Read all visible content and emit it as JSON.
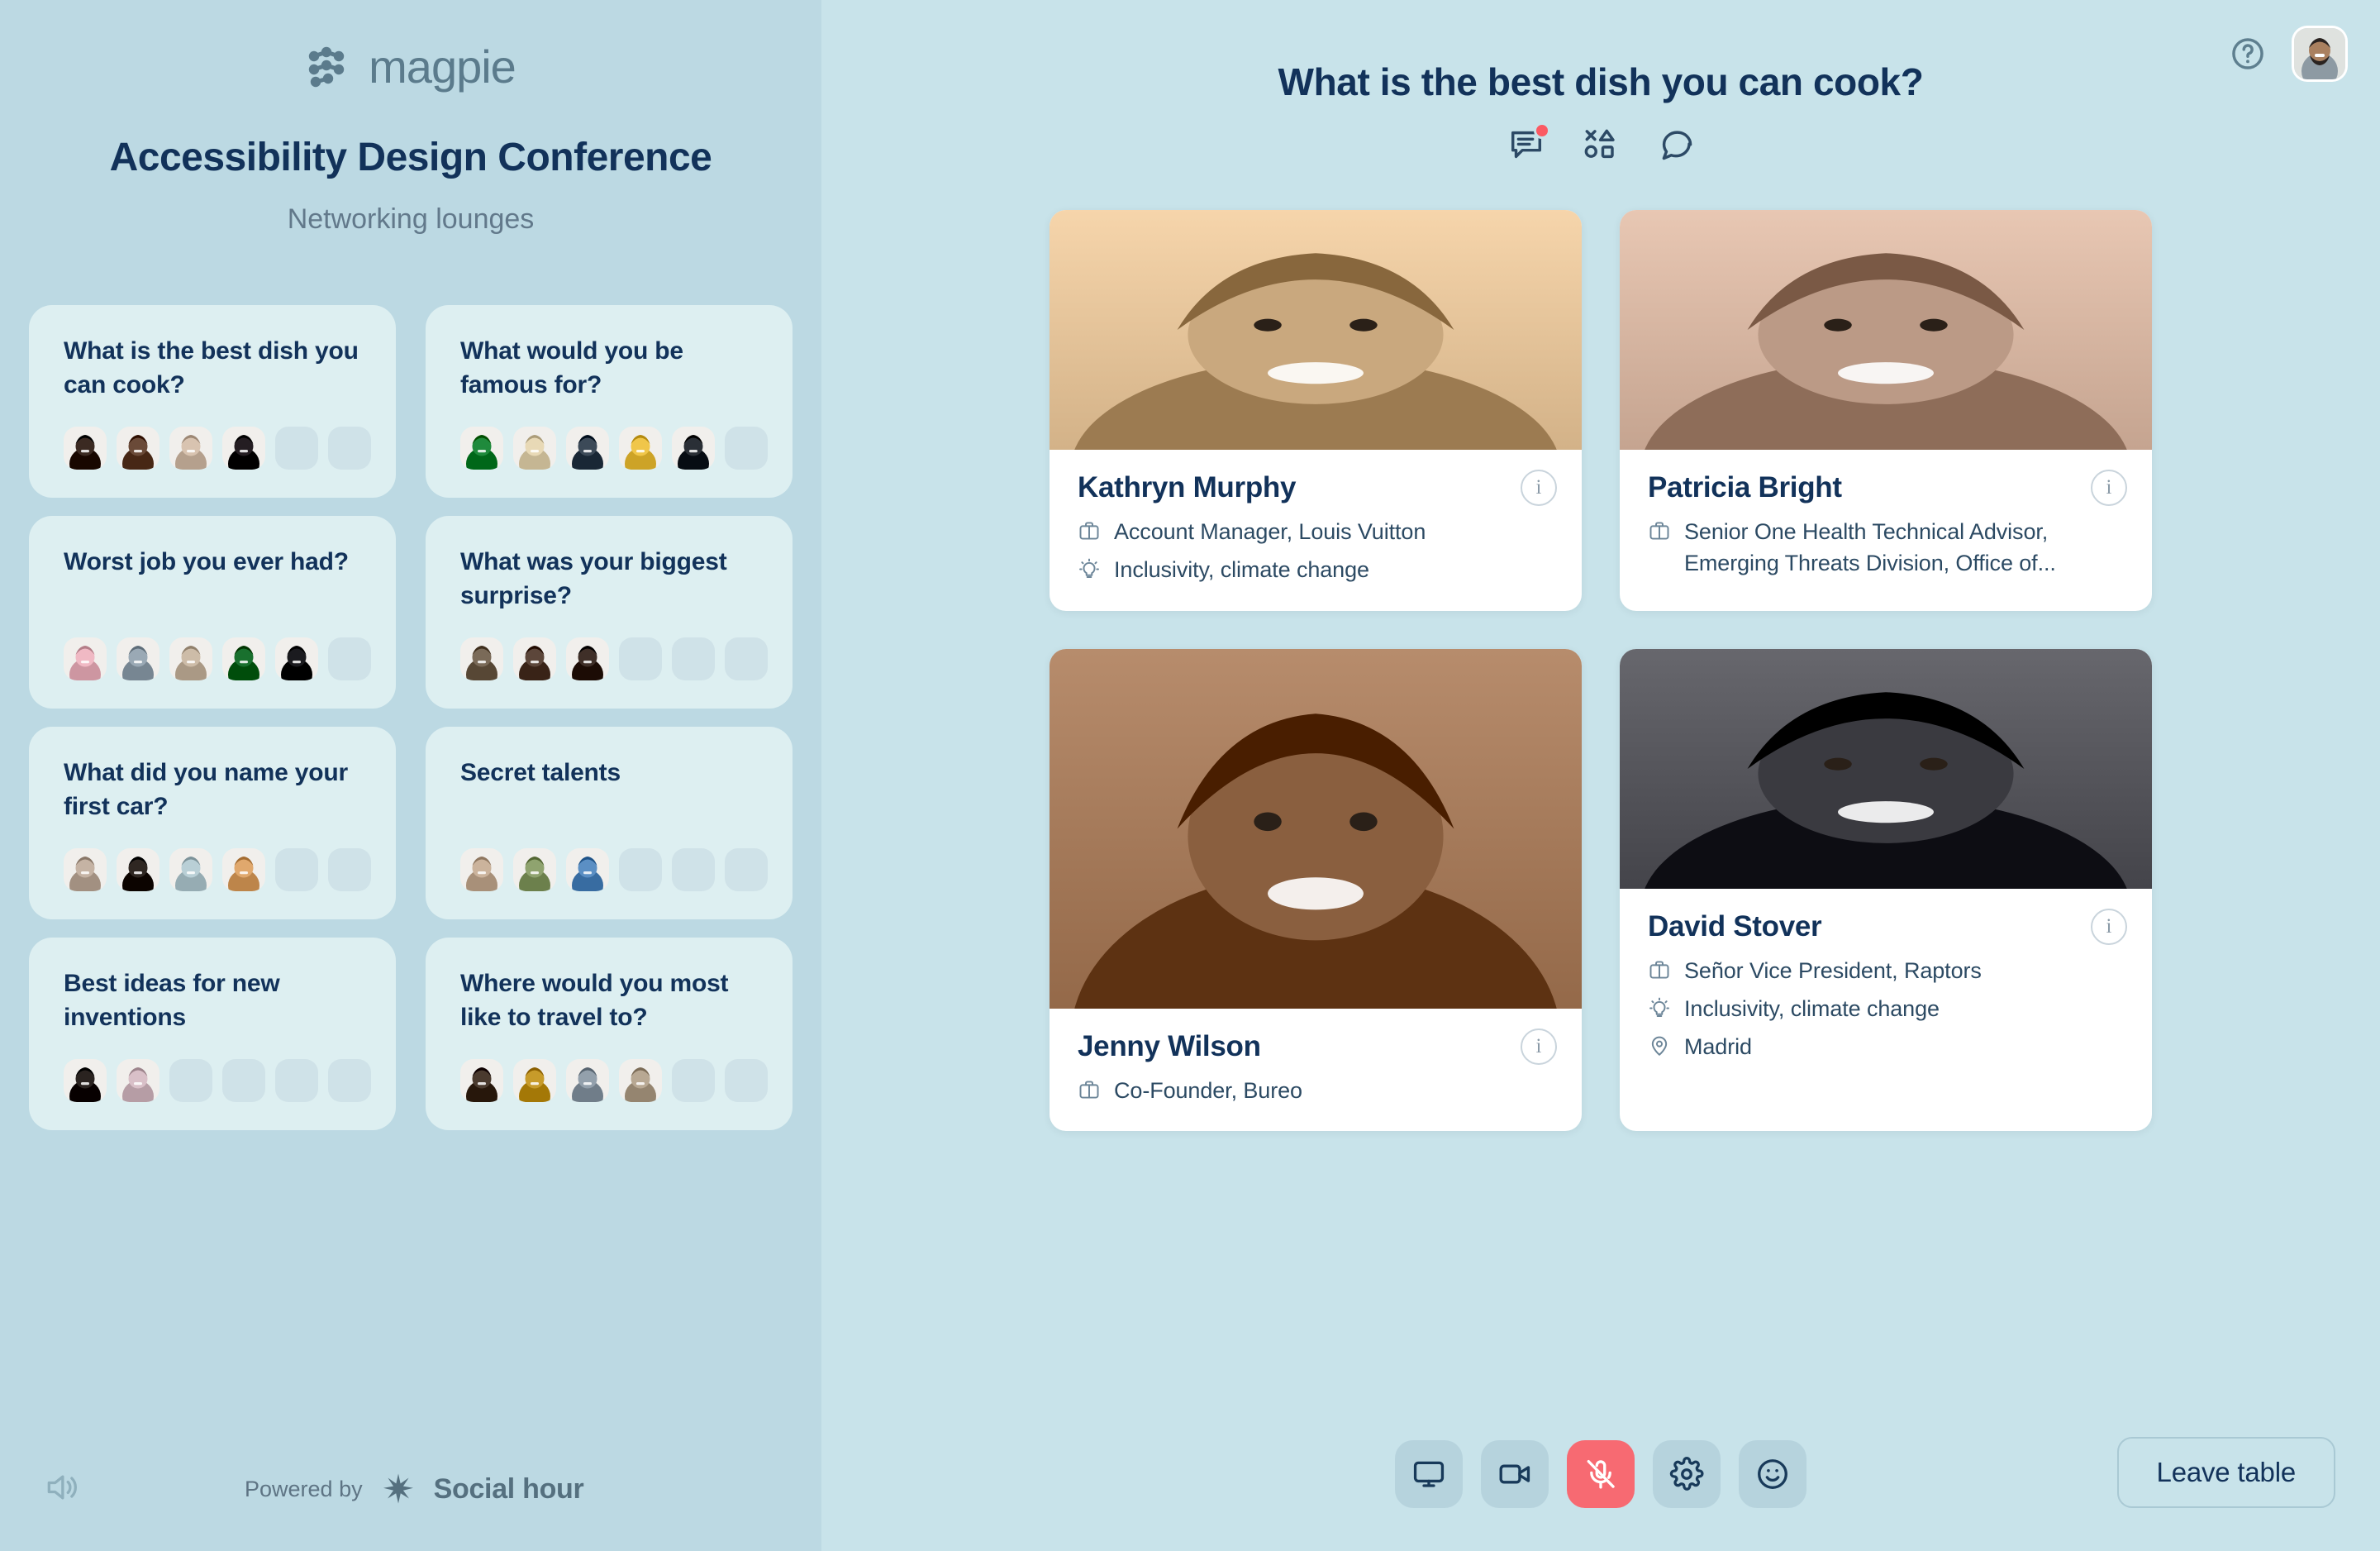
{
  "brand": {
    "name": "magpie",
    "logo_icon": "magpie-dots-logo"
  },
  "conference": {
    "title": "Accessibility Design Conference",
    "subtitle": "Networking lounges"
  },
  "lounges": [
    {
      "question": "What is the best dish you can cook?",
      "filled": 4,
      "total": 6,
      "avatars": [
        "#3b2a22",
        "#6a4a38",
        "#d8c3b0",
        "#241d22"
      ]
    },
    {
      "question": "What would you be famous for?",
      "filled": 5,
      "total": 6,
      "avatars": [
        "#1f8a3c",
        "#e8d9b6",
        "#3c4a58",
        "#f0c64a",
        "#2a2f36"
      ]
    },
    {
      "question": "Worst job you ever had?",
      "filled": 5,
      "total": 6,
      "avatars": [
        "#f0b9c4",
        "#9aa9b5",
        "#cdbca8",
        "#19702e",
        "#1b1b1f"
      ]
    },
    {
      "question": "What was your biggest surprise?",
      "filled": 3,
      "total": 6,
      "avatars": [
        "#7a6a58",
        "#5c463a",
        "#3f2f28"
      ]
    },
    {
      "question": "What did you name your first car?",
      "filled": 4,
      "total": 6,
      "avatars": [
        "#c5b3a4",
        "#2f2722",
        "#b9cfd6",
        "#e0a86d"
      ]
    },
    {
      "question": "Secret talents",
      "filled": 3,
      "total": 6,
      "avatars": [
        "#cbb39c",
        "#8fa36f",
        "#5b8fc4"
      ]
    },
    {
      "question": "Best ideas for new inventions",
      "filled": 2,
      "total": 6,
      "avatars": [
        "#2a2320",
        "#d9c0c8"
      ]
    },
    {
      "question": "Where would you most like to travel to?",
      "filled": 4,
      "total": 6,
      "avatars": [
        "#4a3a2e",
        "#c79b2a",
        "#93a0ac",
        "#b8a893"
      ]
    }
  ],
  "sidebar_footer": {
    "speaker_icon": "speaker-icon",
    "powered_label": "Powered by",
    "partner_name": "Social hour",
    "partner_icon": "social-hour-star-icon"
  },
  "topbar": {
    "help_icon": "help-circle-icon",
    "avatar_icon": "user-avatar",
    "avatar_color": "#8a6a52"
  },
  "room": {
    "title": "What is the best dish you can cook?",
    "actions": [
      {
        "icon": "notes-icon",
        "label": "Notes",
        "has_badge": true
      },
      {
        "icon": "games-shapes-icon",
        "label": "Games",
        "has_badge": false
      },
      {
        "icon": "chat-bubble-icon",
        "label": "Chat",
        "has_badge": false
      }
    ],
    "badge_color": "#fb5a63"
  },
  "people": [
    {
      "name": "Kathryn Murphy",
      "photo_tone": "#c9a87e",
      "photo_tall": false,
      "info_icon": "info-circle-icon",
      "rows": [
        {
          "icon": "briefcase-icon",
          "text": "Account Manager, Louis Vuitton"
        },
        {
          "icon": "lightbulb-icon",
          "text": "Inclusivity, climate change"
        }
      ]
    },
    {
      "name": "Patricia Bright",
      "photo_tone": "#bb9a86",
      "photo_tall": false,
      "info_icon": "info-circle-icon",
      "rows": [
        {
          "icon": "briefcase-icon",
          "text": "Senior One Health Technical Advisor, Emerging Threats Division, Office of..."
        }
      ]
    },
    {
      "name": "Jenny Wilson",
      "photo_tone": "#8a5f3f",
      "photo_tall": true,
      "info_icon": "info-circle-icon",
      "rows": [
        {
          "icon": "briefcase-icon",
          "text": "Co-Founder, Bureo"
        }
      ]
    },
    {
      "name": "David Stover",
      "photo_tone": "#3a3a40",
      "photo_tall": false,
      "info_icon": "info-circle-icon",
      "rows": [
        {
          "icon": "briefcase-icon",
          "text": "Señor Vice President, Raptors"
        },
        {
          "icon": "lightbulb-icon",
          "text": "Inclusivity, climate change"
        },
        {
          "icon": "location-pin-icon",
          "text": "Madrid"
        }
      ]
    }
  ],
  "controls": [
    {
      "icon": "screen-share-icon",
      "label": "Share screen",
      "active": false
    },
    {
      "icon": "video-camera-icon",
      "label": "Camera",
      "active": false
    },
    {
      "icon": "microphone-muted-icon",
      "label": "Microphone muted",
      "active": true
    },
    {
      "icon": "gear-icon",
      "label": "Settings",
      "active": false
    },
    {
      "icon": "smiley-icon",
      "label": "Reactions",
      "active": false
    }
  ],
  "leave_button": {
    "label": "Leave table"
  }
}
